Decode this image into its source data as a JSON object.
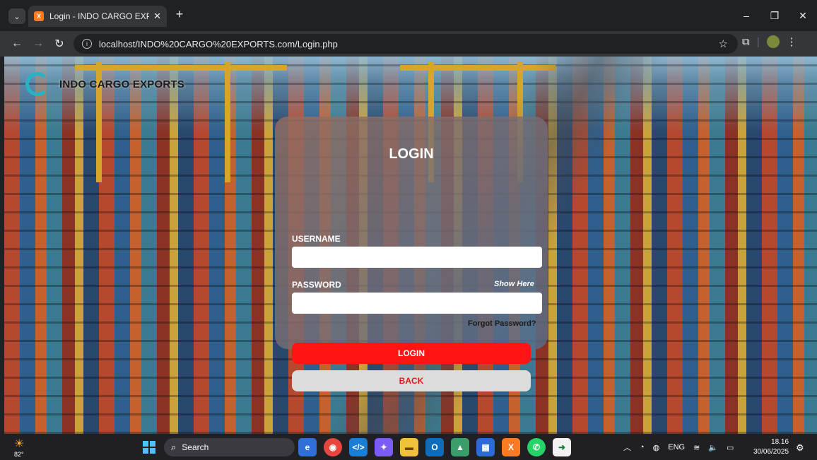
{
  "browser": {
    "tab_title": "Login - INDO CARGO EXPORTS",
    "tab_close": "✕",
    "new_tab": "+",
    "url": "localhost/INDO%20CARGO%20EXPORTS.com/Login.php"
  },
  "brand": {
    "name": "INDO CARGO EXPORTS"
  },
  "login": {
    "title": "LOGIN",
    "username_label": "USERNAME",
    "username_value": "",
    "password_label": "PASSWORD",
    "password_value": "",
    "show_password": "Show Here",
    "forgot_password": "Forgot Password?",
    "login_button": "LOGIN",
    "back_button": "BACK"
  },
  "taskbar": {
    "temperature": "82°",
    "search_label": "Search",
    "language": "ENG",
    "time": "18.16",
    "date": "30/06/2025"
  },
  "icons": [
    "tab-list-icon",
    "xampp-favicon",
    "back-icon",
    "forward-icon",
    "reload-icon",
    "site-info-icon",
    "bookmark-star-icon",
    "extensions-icon",
    "profile-icon",
    "menu-icon",
    "start-icon",
    "search-icon",
    "edge-icon",
    "chrome-icon",
    "vscode-icon",
    "copilot-icon",
    "file-explorer-icon",
    "outlook-icon",
    "photos-icon",
    "store-icon",
    "xampp-icon",
    "whatsapp-icon",
    "app-icon",
    "chevron-up-icon",
    "wifi-icon",
    "volume-icon",
    "battery-icon",
    "notification-icon"
  ],
  "colors": {
    "login_button": "#ff1414",
    "back_button": "#dcdcdc",
    "back_text": "#e01a1a",
    "brand_logo": "#27b3c4"
  }
}
